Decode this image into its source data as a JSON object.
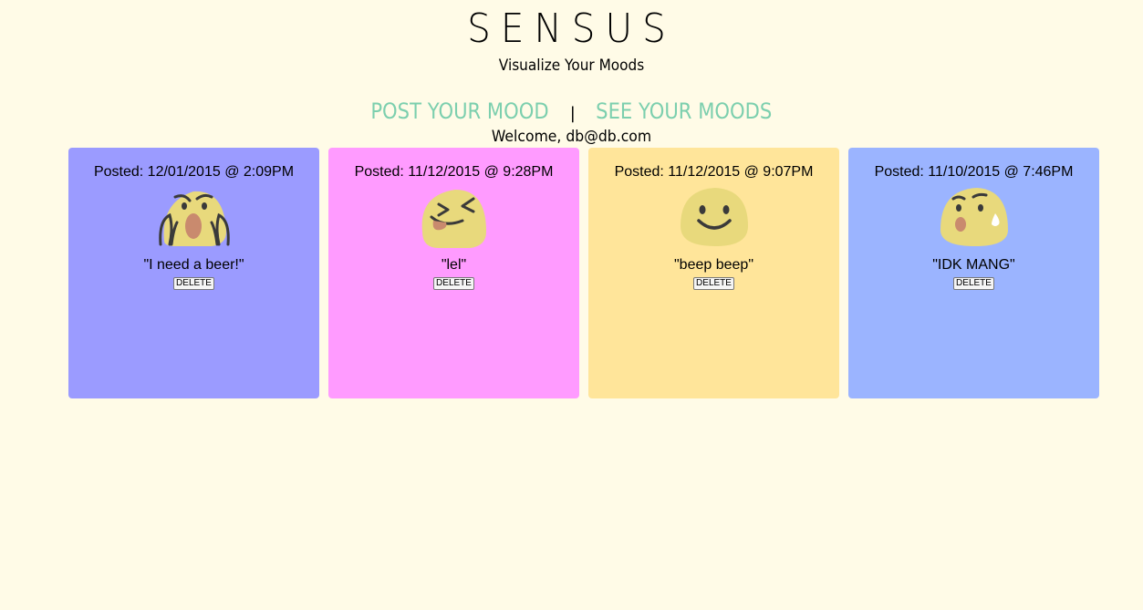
{
  "header": {
    "title": "SENSUS",
    "subtitle": "Visualize Your Moods"
  },
  "nav": {
    "post_mood": "POST YOUR MOOD",
    "separator": "|",
    "see_moods": "SEE YOUR MOODS",
    "link_color": "#7ccfae"
  },
  "welcome": "Welcome, db@db.com",
  "moods": [
    {
      "posted": "Posted: 12/01/2015 @ 2:09PM",
      "quote": "\"I need a beer!\"",
      "delete_label": "DELETE",
      "color": "#9b9bff",
      "icon": "screaming-face-icon"
    },
    {
      "posted": "Posted: 11/12/2015 @ 9:28PM",
      "quote": "\"lel\"",
      "delete_label": "DELETE",
      "color": "#ff9bff",
      "icon": "tongue-out-face-icon"
    },
    {
      "posted": "Posted: 11/12/2015 @ 9:07PM",
      "quote": "\"beep beep\"",
      "delete_label": "DELETE",
      "color": "#ffe59a",
      "icon": "smiling-face-icon"
    },
    {
      "posted": "Posted: 11/10/2015 @ 7:46PM",
      "quote": "\"IDK MANG\"",
      "delete_label": "DELETE",
      "color": "#9bb4ff",
      "icon": "anxious-sweat-face-icon"
    }
  ]
}
